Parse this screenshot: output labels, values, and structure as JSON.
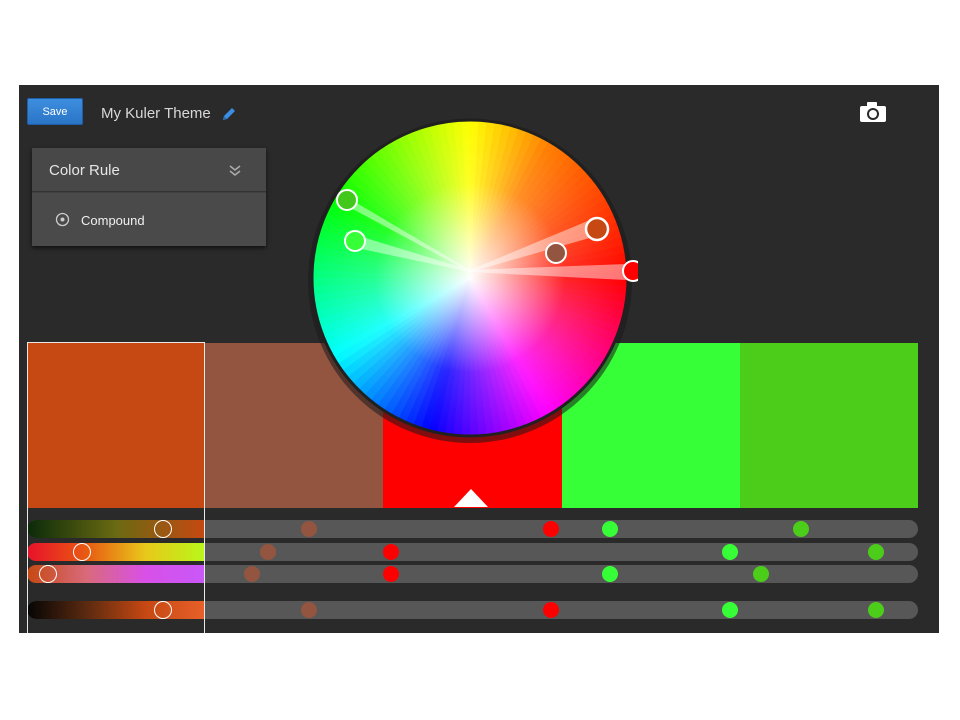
{
  "toolbar": {
    "save_label": "Save",
    "theme_title": "My Kuler Theme"
  },
  "color_rule": {
    "title": "Color Rule",
    "selected": "Compound"
  },
  "icons": {
    "edit": "pencil-icon",
    "camera": "camera-icon",
    "collapse": "double-chevron-down-icon",
    "radio": "radio-icon"
  },
  "accent_color": "#2a74c6",
  "swatches": [
    "#c64812",
    "#935540",
    "#ff0000",
    "#37ff37",
    "#4ccd1a"
  ],
  "selected_swatch_index": 0
}
